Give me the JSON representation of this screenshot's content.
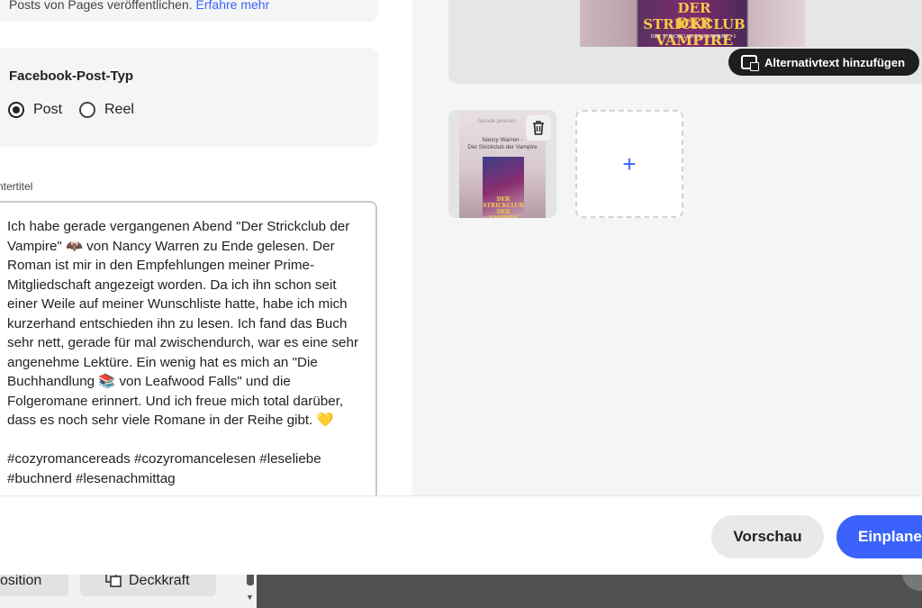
{
  "info_card": {
    "text": "Posts von Pages veröffentlichen.",
    "link": "Erfahre mehr"
  },
  "post_type": {
    "title": "Facebook-Post-Typ",
    "options": [
      {
        "label": "Post",
        "selected": true
      },
      {
        "label": "Reel",
        "selected": false
      }
    ]
  },
  "caption": {
    "label": "ntertitel",
    "text": "Ich habe gerade vergangenen Abend \"Der Strickclub der Vampire\" 🦇 von Nancy Warren zu Ende gelesen. Der Roman ist mir in den Empfehlungen meiner Prime-Mitgliedschaft angezeigt worden. Da ich ihn schon seit einer Weile auf meiner Wunschliste hatte, habe ich mich kurzerhand entschieden ihn zu lesen. Ich fand das Buch sehr nett, gerade für mal zwischendurch, war es eine sehr angenehme Lektüre. Ein wenig hat es mich an \"Die Buchhandlung 📚 von Leafwood Falls\" und die Folgeromane erinnert. Und ich freue mich total darüber, dass es noch sehr viele Romane in der Reihe gibt. 💛\n\n#cozyromancereads #cozyromancelesen #leseliebe #buchnerd #lesenachmittag"
  },
  "media": {
    "preview_title_line1": "DER STRICKCLUB",
    "preview_title_line2": "DER VAMPIRE",
    "preview_subtitle": "DER STRICKCLUB DER VAMPIRE · 1",
    "alt_text_button": "Alternativtext hinzufügen",
    "thumb_brand": "Gerade gelesen",
    "thumb_author": "Nancy Warren -\nDer Strickclub der Vampire",
    "thumb_cover_title": "DER STRICKCLUB DER VAMPIRE",
    "add_symbol": "+"
  },
  "footer": {
    "preview_button": "Vorschau",
    "schedule_button": "Einplanen"
  },
  "background": {
    "chip_position": "osition",
    "chip_opacity": "Deckkraft"
  },
  "colors": {
    "accent": "#3b63fb",
    "panel": "#f5f5f5",
    "dark_button": "#1e1e1e"
  }
}
